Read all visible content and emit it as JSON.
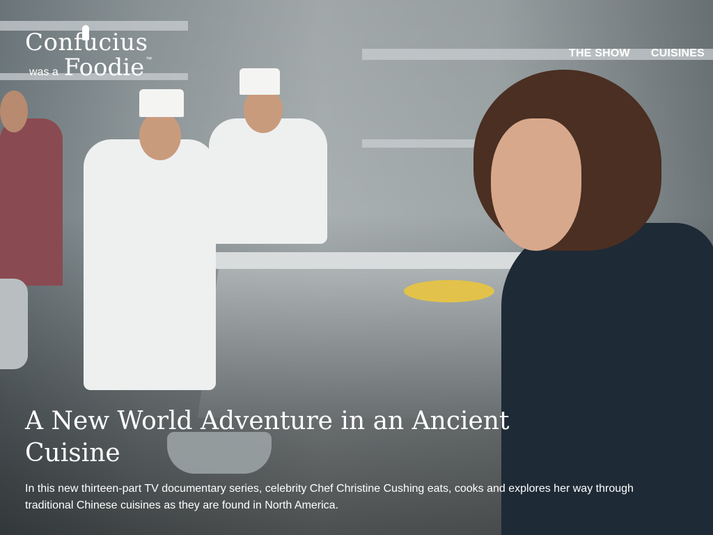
{
  "logo": {
    "line1": "Confucius",
    "was": "was a",
    "foodie": "Foodie",
    "tm": "™"
  },
  "nav": {
    "items": [
      "THE SHOW",
      "CUISINES"
    ]
  },
  "hero": {
    "headline": "A New World Adventure in an Ancient Cuisine",
    "description": "In this new thirteen-part TV documentary series, celebrity Chef Christine Cushing eats, cooks and explores her way through traditional Chinese cuisines as they are found in North America."
  }
}
